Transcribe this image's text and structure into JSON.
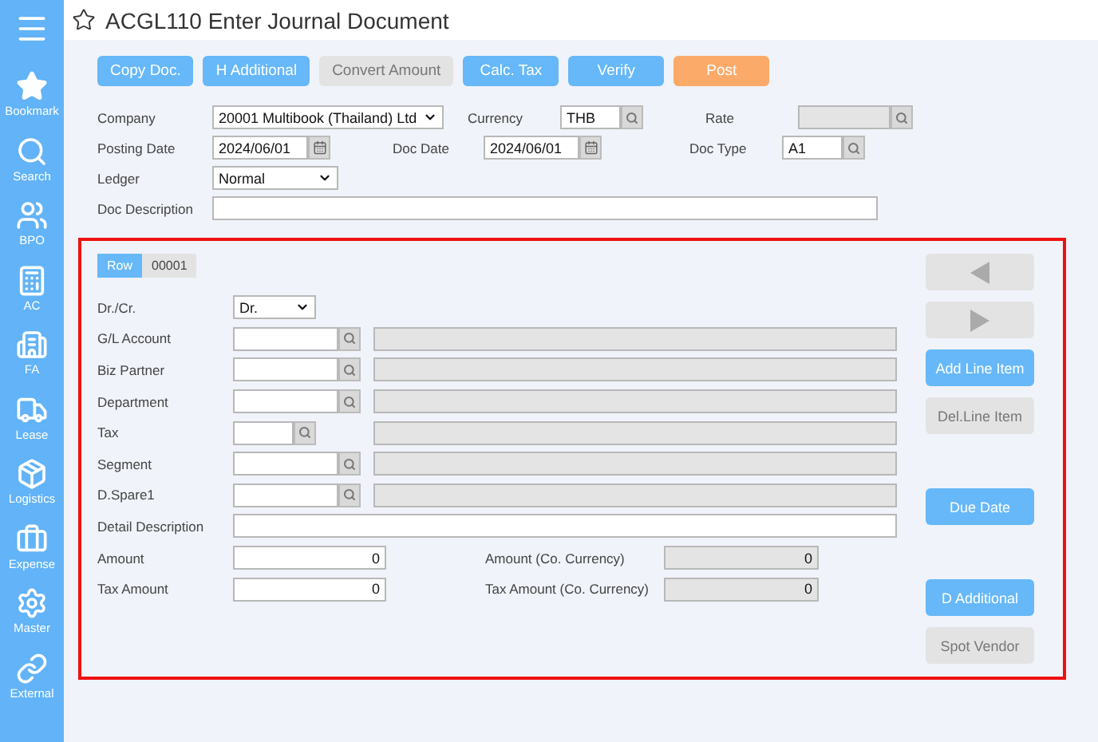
{
  "sidebar": {
    "items": [
      {
        "label": "Bookmark"
      },
      {
        "label": "Search"
      },
      {
        "label": "BPO"
      },
      {
        "label": "AC"
      },
      {
        "label": "FA"
      },
      {
        "label": "Lease"
      },
      {
        "label": "Logistics"
      },
      {
        "label": "Expense"
      },
      {
        "label": "Master"
      },
      {
        "label": "External"
      }
    ]
  },
  "window": {
    "title": "ACGL110 Enter Journal Document"
  },
  "toolbar": [
    {
      "label": "Copy Doc.",
      "kind": "primary"
    },
    {
      "label": "H Additional",
      "kind": "primary"
    },
    {
      "label": "Convert Amount",
      "kind": "disabled"
    },
    {
      "label": "Calc. Tax",
      "kind": "primary"
    },
    {
      "label": "Verify",
      "kind": "primary"
    },
    {
      "label": "Post",
      "kind": "warning"
    }
  ],
  "header_rows": [
    [
      {
        "label": "Company",
        "kind": "select",
        "value": "20001 Multibook (Thailand) Ltd"
      },
      {
        "label": "Currency",
        "kind": "lookup",
        "value": "THB"
      },
      {
        "label": "Rate",
        "kind": "lookup_readonly"
      }
    ],
    [
      {
        "label": "Posting Date",
        "kind": "date",
        "value": "2024/06/01"
      },
      {
        "label": "Doc Date",
        "kind": "date",
        "value": "2024/06/01"
      },
      {
        "label": "Doc Type",
        "kind": "lookup",
        "value": "A1"
      }
    ],
    [
      {
        "label": "Ledger",
        "kind": "select",
        "value": "Normal"
      }
    ],
    [
      {
        "label": "Doc Description",
        "kind": "text"
      }
    ]
  ],
  "line_item": {
    "row_tab": {
      "label": "Row",
      "value": "00001"
    },
    "fields": [
      {
        "label": "Dr./Cr.",
        "kind": "select",
        "value": "Dr."
      },
      {
        "label": "G/L Account",
        "kind": "lookup"
      },
      {
        "label": "Biz Partner",
        "kind": "lookup"
      },
      {
        "label": "Department",
        "kind": "lookup"
      },
      {
        "label": "Tax",
        "kind": "lookup_short"
      },
      {
        "label": "Segment",
        "kind": "lookup"
      },
      {
        "label": "D.Spare1",
        "kind": "lookup"
      },
      {
        "label": "Detail Description",
        "kind": "text"
      },
      {
        "label": "Amount",
        "kind": "amount",
        "value": "0",
        "co_label": "Amount (Co. Currency)",
        "co_value": "0"
      },
      {
        "label": "Tax Amount",
        "kind": "amount",
        "value": "0",
        "co_label": "Tax Amount (Co. Currency)",
        "co_value": "0"
      }
    ],
    "side_buttons": [
      {
        "kind": "prev",
        "disabled": true
      },
      {
        "kind": "next",
        "disabled": true
      },
      {
        "kind": "text",
        "label": "Add Line Item",
        "disabled": false
      },
      {
        "kind": "text",
        "label": "Del.Line Item",
        "disabled": true
      },
      {
        "kind": "gap"
      },
      {
        "kind": "text",
        "label": "Due Date",
        "disabled": false
      },
      {
        "kind": "gap"
      },
      {
        "kind": "text",
        "label": "D Additional",
        "disabled": false
      },
      {
        "kind": "text",
        "label": "Spot Vendor",
        "disabled": true
      }
    ]
  }
}
